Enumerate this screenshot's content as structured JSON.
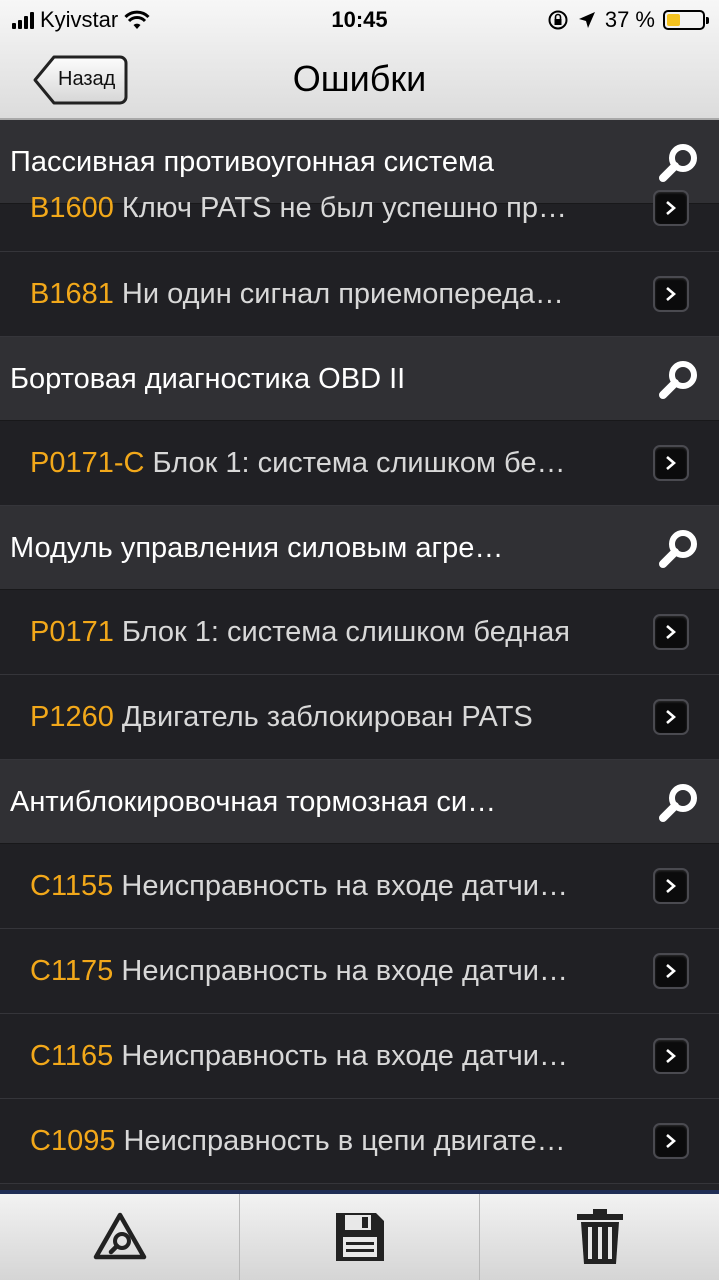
{
  "status_bar": {
    "carrier": "Kyivstar",
    "time": "10:45",
    "battery_percent": "37 %",
    "battery_level": 0.37,
    "icons": [
      "signal-icon",
      "wifi-icon",
      "orientation-lock-icon",
      "location-arrow-icon",
      "battery-icon"
    ]
  },
  "nav": {
    "back_label": "Назад",
    "title": "Ошибки"
  },
  "sections": [
    {
      "title": "Пассивная противоугонная система",
      "errors": [
        {
          "code": "B1600",
          "desc": "Ключ PATS не был успешно пр…"
        },
        {
          "code": "B1681",
          "desc": "Ни один сигнал приемопереда…"
        }
      ]
    },
    {
      "title": "Бортовая диагностика OBD II",
      "errors": [
        {
          "code": "P0171-C",
          "desc": "Блок 1: система слишком бе…"
        }
      ]
    },
    {
      "title": "Модуль управления силовым агре…",
      "errors": [
        {
          "code": "P0171",
          "desc": "Блок 1: система слишком бедная"
        },
        {
          "code": "P1260",
          "desc": "Двигатель заблокирован PATS"
        }
      ]
    },
    {
      "title": "Антиблокировочная тормозная си…",
      "errors": [
        {
          "code": "C1155",
          "desc": "Неисправность на входе датчи…"
        },
        {
          "code": "C1175",
          "desc": "Неисправность на входе датчи…"
        },
        {
          "code": "C1165",
          "desc": "Неисправность на входе датчи…"
        },
        {
          "code": "C1095",
          "desc": "Неисправность в цепи двигате…"
        }
      ]
    }
  ],
  "toolbar": {
    "icons": [
      "warning-search-icon",
      "save-icon",
      "trash-icon"
    ]
  },
  "colors": {
    "code": "#f2a81a",
    "desc": "#d8d8d8",
    "section_bg": "#303034",
    "row_bg": "#202024",
    "battery": "#f4c21f"
  }
}
